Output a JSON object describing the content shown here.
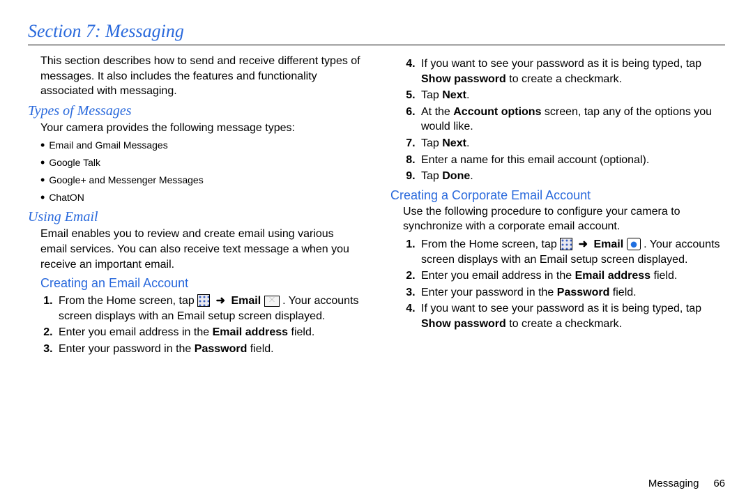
{
  "section_title": "Section 7: Messaging",
  "intro": "This section describes how to send and receive different types of messages. It also includes the features and functionality associated with messaging.",
  "types": {
    "heading": "Types of Messages",
    "lead": "Your camera provides the following message types:",
    "items": [
      "Email and Gmail Messages",
      "Google Talk",
      "Google+ and Messenger Messages",
      "ChatON"
    ]
  },
  "using_email": {
    "heading": "Using Email",
    "lead": "Email enables you to review and create email using various email services. You can also receive text message a when you receive an important email."
  },
  "create": {
    "heading": "Creating an Email Account",
    "step1a": "From the Home screen, tap ",
    "step1b": "Email",
    "step1c": ". Your accounts screen displays with an Email setup screen displayed.",
    "step2a": "Enter you email address in the ",
    "step2b": "Email address",
    "step2c": " field.",
    "step3a": "Enter your password in the ",
    "step3b": "Password",
    "step3c": " field.",
    "step4a": "If you want to see your password as it is being typed, tap ",
    "step4b": "Show password",
    "step4c": " to create a checkmark.",
    "step5a": "Tap ",
    "step5b": "Next",
    "step5c": ".",
    "step6a": "At the ",
    "step6b": "Account options",
    "step6c": " screen, tap any of the options you would like.",
    "step7a": "Tap ",
    "step7b": "Next",
    "step7c": ".",
    "step8": "Enter a name for this email account (optional).",
    "step9a": "Tap ",
    "step9b": "Done",
    "step9c": "."
  },
  "corp": {
    "heading": "Creating a Corporate Email Account",
    "lead": "Use the following procedure to configure your camera to synchronize with a corporate email account.",
    "step1a": "From the Home screen, tap ",
    "step1b": "Email",
    "step1c": ". Your accounts screen displays with an Email setup screen displayed.",
    "step2a": "Enter you email address in the ",
    "step2b": "Email address",
    "step2c": " field.",
    "step3a": "Enter your password in the ",
    "step3b": "Password",
    "step3c": " field.",
    "step4a": "If you want to see your password as it is being typed, tap ",
    "step4b": "Show password",
    "step4c": " to create a checkmark."
  },
  "footer": {
    "label": "Messaging",
    "page": "66"
  },
  "icons": {
    "apps": "apps-grid-icon",
    "arrow": "➜",
    "email_envelope": "email-envelope-icon",
    "email_badge": "email-badge-icon"
  }
}
